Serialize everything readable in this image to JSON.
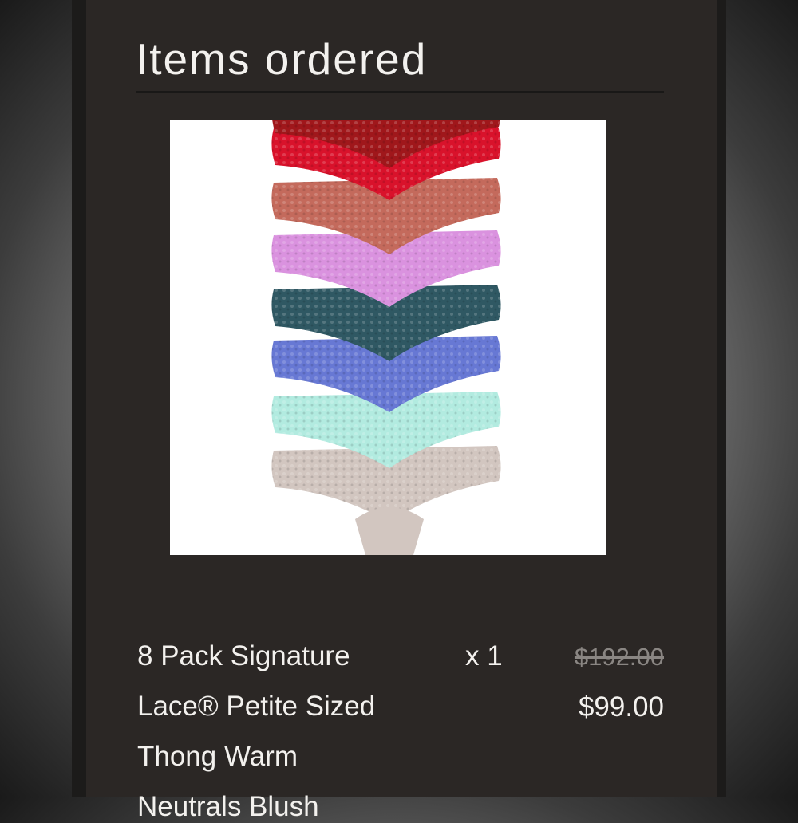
{
  "section_title": "Items ordered",
  "item": {
    "name_lines": [
      "8 Pack Signature",
      "Lace® Petite Sized",
      "Thong Warm",
      "Neutrals Blush"
    ],
    "quantity": "x 1",
    "original_price": "$192.00",
    "sale_price": "$99.00",
    "image_colors": [
      "#a0171b",
      "#d9122b",
      "#c46a5c",
      "#da92df",
      "#2f5863",
      "#6778d4",
      "#b2ebe0",
      "#d2c6c0"
    ]
  }
}
